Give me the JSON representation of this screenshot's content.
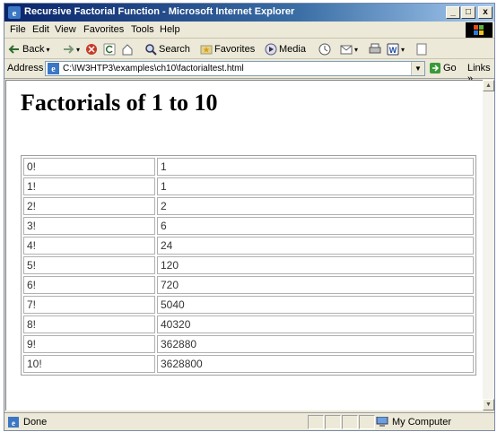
{
  "window": {
    "title": "Recursive Factorial Function - Microsoft Internet Explorer",
    "controls": {
      "minimize": "_",
      "maximize": "□",
      "close": "x"
    }
  },
  "menu": [
    "File",
    "Edit",
    "View",
    "Favorites",
    "Tools",
    "Help"
  ],
  "toolbar": {
    "back_label": "Back",
    "search_label": "Search",
    "favorites_label": "Favorites",
    "media_label": "Media"
  },
  "address": {
    "label": "Address",
    "value": "C:\\IW3HTP3\\examples\\ch10\\factorialtest.html",
    "go_label": "Go",
    "links_label": "Links »"
  },
  "page": {
    "heading": "Factorials of 1 to 10",
    "rows": [
      {
        "n": "0!",
        "value": "1"
      },
      {
        "n": "1!",
        "value": "1"
      },
      {
        "n": "2!",
        "value": "2"
      },
      {
        "n": "3!",
        "value": "6"
      },
      {
        "n": "4!",
        "value": "24"
      },
      {
        "n": "5!",
        "value": "120"
      },
      {
        "n": "6!",
        "value": "720"
      },
      {
        "n": "7!",
        "value": "5040"
      },
      {
        "n": "8!",
        "value": "40320"
      },
      {
        "n": "9!",
        "value": "362880"
      },
      {
        "n": "10!",
        "value": "3628800"
      }
    ]
  },
  "status": {
    "text": "Done",
    "zone": "My Computer"
  },
  "icons": [
    "ie-icon",
    "windows-logo-icon",
    "back-icon",
    "forward-icon",
    "stop-icon",
    "refresh-icon",
    "home-icon",
    "search-icon",
    "favorites-icon",
    "media-icon",
    "history-icon",
    "mail-icon",
    "print-icon",
    "word-icon",
    "page-icon",
    "go-icon",
    "computer-icon"
  ],
  "colors": {
    "titlebar": "#0a246a",
    "chrome": "#ece9d8"
  }
}
